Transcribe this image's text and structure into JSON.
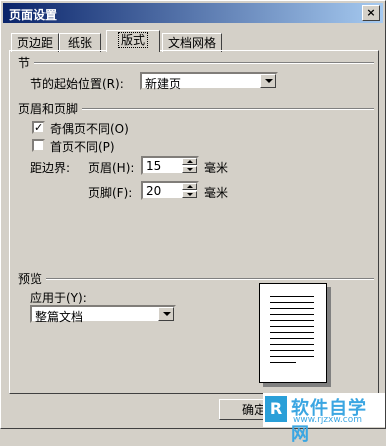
{
  "window": {
    "title": "页面设置",
    "close_glyph": "×"
  },
  "tabs": [
    {
      "label": "页边距"
    },
    {
      "label": "纸张"
    },
    {
      "label": "版式",
      "active": true
    },
    {
      "label": "文档网格"
    }
  ],
  "section_group": {
    "title": "节",
    "start_label": "节的起始位置(R):",
    "start_value": "新建页"
  },
  "header_footer_group": {
    "title": "页眉和页脚",
    "odd_even": {
      "label": "奇偶页不同(O)",
      "checked": true
    },
    "first_page": {
      "label": "首页不同(P)",
      "checked": false
    },
    "distance_label": "距边界:",
    "header": {
      "label": "页眉(H):",
      "value": "15",
      "unit": "毫米"
    },
    "footer": {
      "label": "页脚(F):",
      "value": "20",
      "unit": "毫米"
    }
  },
  "preview_group": {
    "title": "预览",
    "apply_label": "应用于(Y):",
    "apply_value": "整篇文档"
  },
  "buttons": {
    "ok": "确定"
  },
  "watermark": {
    "logo": "R",
    "main": "软件自学网",
    "sub": "www.rjzxw.com"
  },
  "colors": {
    "face": "#d4d0c8",
    "title_start": "#0a246a",
    "title_end": "#a6caf0",
    "watermark": "#3ba6e2"
  },
  "icons": {
    "check": "check-icon",
    "dropdown": "chevron-down-icon",
    "spin_up": "arrow-up-icon",
    "spin_down": "arrow-down-icon"
  }
}
